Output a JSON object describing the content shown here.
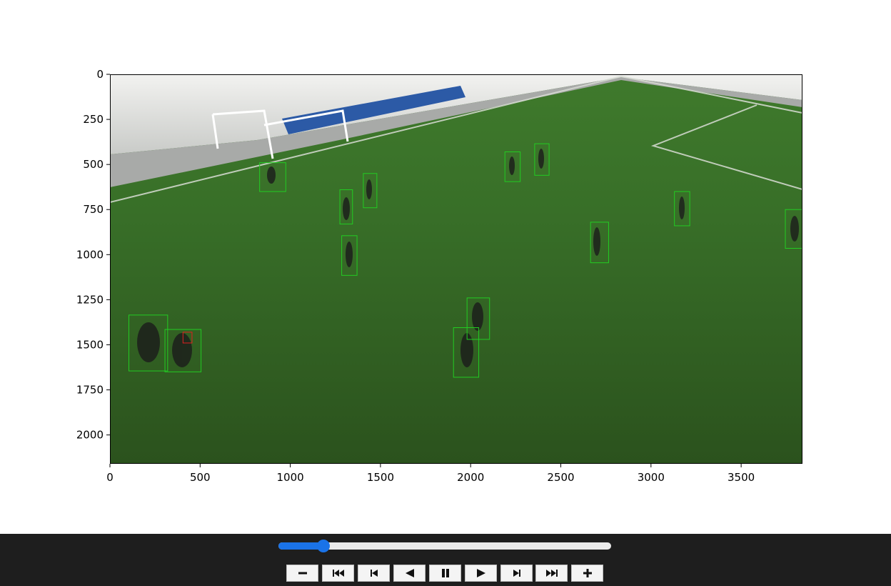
{
  "playback": {
    "frame_fraction": 0.135,
    "buttons": [
      "zoom-out",
      "first-frame",
      "step-back",
      "play-reverse",
      "pause",
      "play-forward",
      "step-forward",
      "last-frame",
      "zoom-in"
    ]
  },
  "colors": {
    "box": "#22cc22",
    "highlight_box": "#e02020",
    "control_bar": "#1e1e1e",
    "slider_accent": "#1a73e8"
  },
  "chart_data": {
    "type": "image",
    "title": "",
    "xlabel": "",
    "ylabel": "",
    "xlim": [
      0,
      3840
    ],
    "ylim": [
      2160,
      0
    ],
    "x_ticks": [
      0,
      500,
      1000,
      1500,
      2000,
      2500,
      3000,
      3500
    ],
    "y_ticks": [
      0,
      250,
      500,
      750,
      1000,
      1250,
      1500,
      1750,
      2000
    ],
    "x_tick_labels": [
      "0",
      "500",
      "1000",
      "1500",
      "2000",
      "2500",
      "3000",
      "3500"
    ],
    "y_tick_labels": [
      "0",
      "250",
      "500",
      "750",
      "1000",
      "1250",
      "1500",
      "1750",
      "2000"
    ],
    "boxes": [
      {
        "x0": 830,
        "y0": 490,
        "x1": 975,
        "y1": 650
      },
      {
        "x0": 1275,
        "y0": 640,
        "x1": 1345,
        "y1": 830
      },
      {
        "x0": 1405,
        "y0": 550,
        "x1": 1480,
        "y1": 740
      },
      {
        "x0": 1285,
        "y0": 895,
        "x1": 1370,
        "y1": 1115
      },
      {
        "x0": 2190,
        "y0": 430,
        "x1": 2275,
        "y1": 595
      },
      {
        "x0": 2355,
        "y0": 385,
        "x1": 2435,
        "y1": 560
      },
      {
        "x0": 3130,
        "y0": 650,
        "x1": 3215,
        "y1": 840
      },
      {
        "x0": 2665,
        "y0": 820,
        "x1": 2765,
        "y1": 1045
      },
      {
        "x0": 3745,
        "y0": 750,
        "x1": 3840,
        "y1": 965
      },
      {
        "x0": 105,
        "y0": 1335,
        "x1": 320,
        "y1": 1645
      },
      {
        "x0": 305,
        "y0": 1415,
        "x1": 505,
        "y1": 1650
      },
      {
        "x0": 1980,
        "y0": 1240,
        "x1": 2105,
        "y1": 1470
      },
      {
        "x0": 1905,
        "y0": 1405,
        "x1": 2045,
        "y1": 1680
      }
    ],
    "highlight_boxes": [
      {
        "x0": 405,
        "y0": 1430,
        "x1": 455,
        "y1": 1490
      }
    ]
  }
}
